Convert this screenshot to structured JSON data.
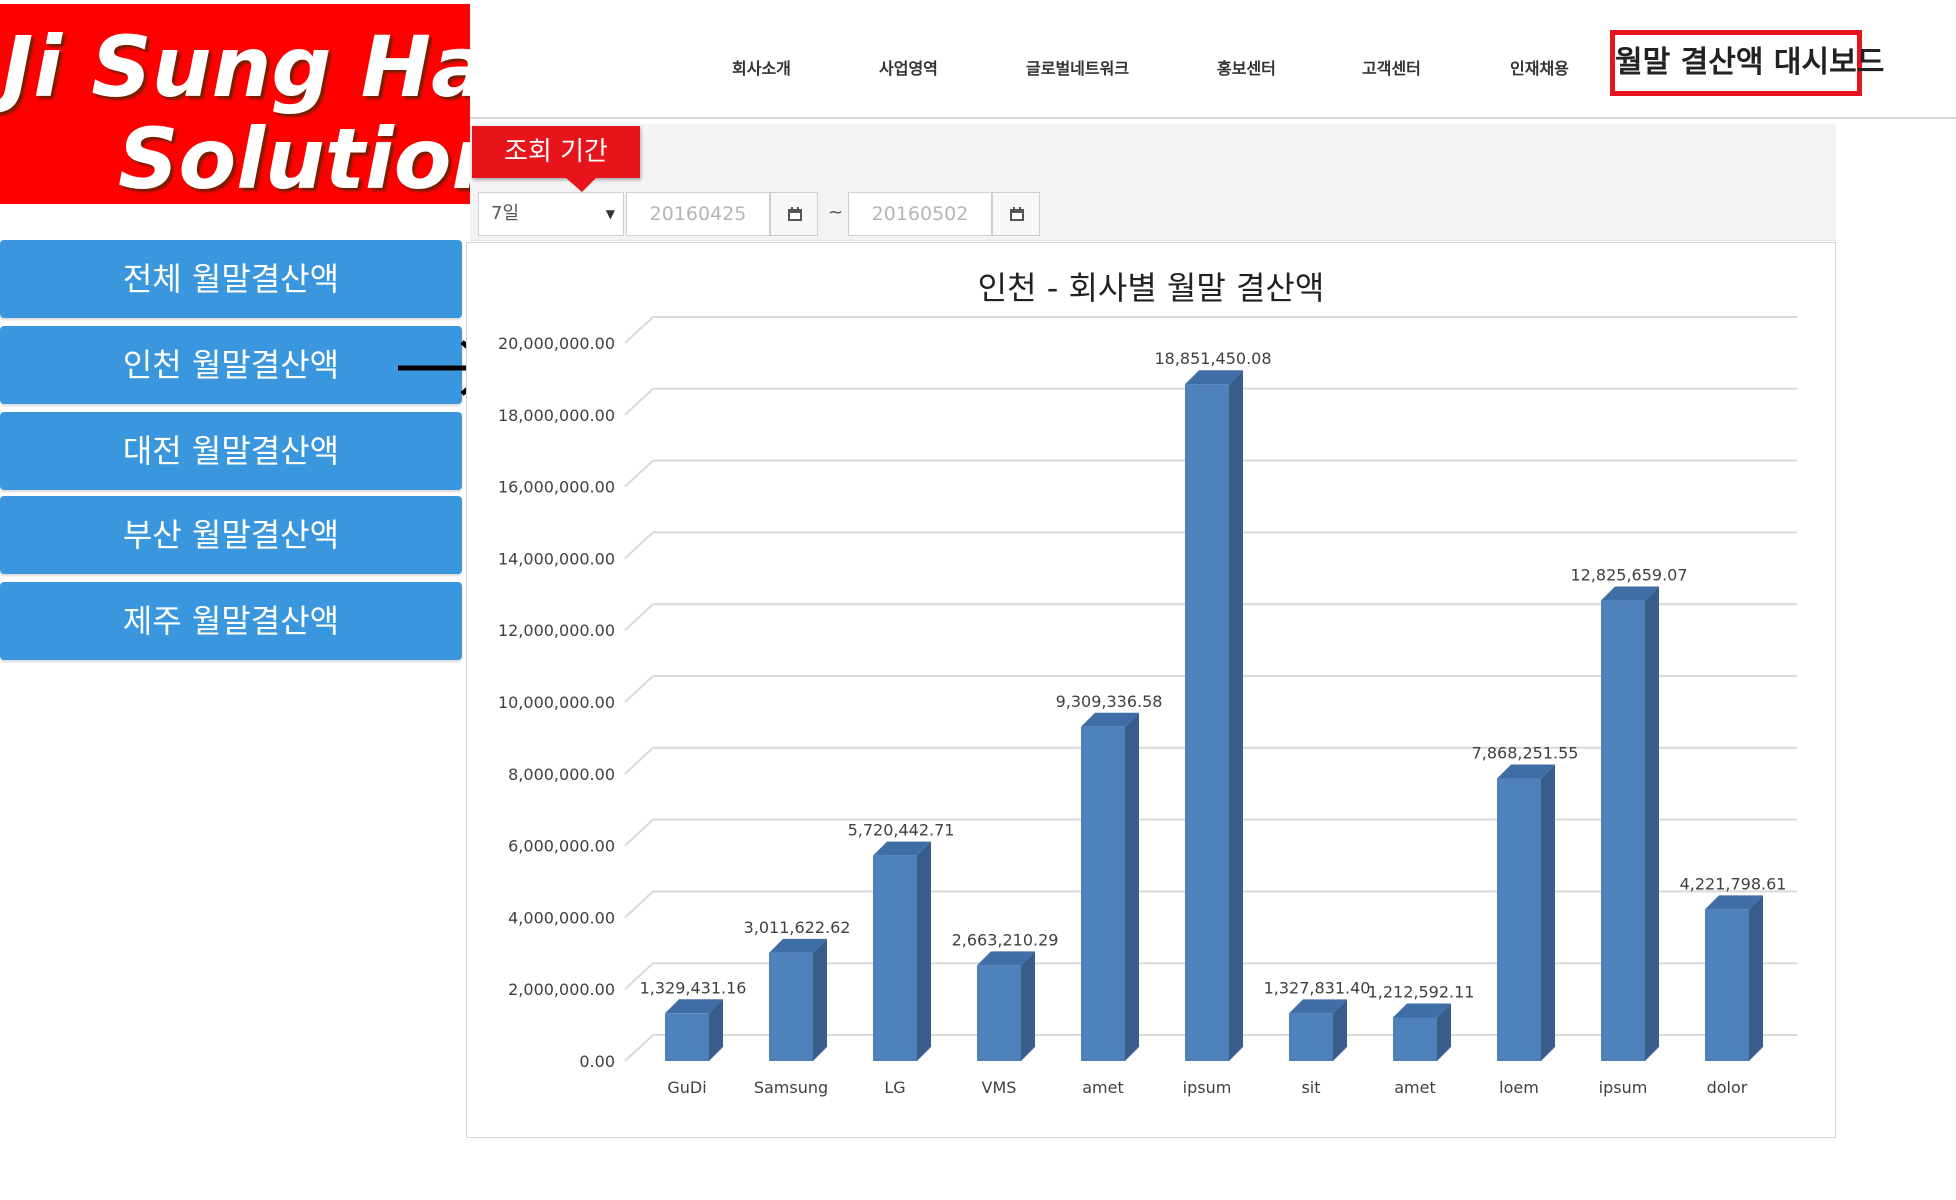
{
  "logo": {
    "line1": "Ji Sung Han",
    "line2": "Solutions"
  },
  "nav": {
    "items": [
      "회사소개",
      "사업영역",
      "글로벌네트워크",
      "홍보센터",
      "고객센터",
      "인재채용"
    ],
    "dashboard_label": "월말 결산액 대시보드"
  },
  "sidebar": {
    "items": [
      {
        "label": "전체 월말결산액"
      },
      {
        "label": "인천 월말결산액"
      },
      {
        "label": "대전 월말결산액"
      },
      {
        "label": "부산 월말결산액"
      },
      {
        "label": "제주 월말결산액"
      }
    ],
    "active_index": 1
  },
  "filter": {
    "tag_label": "조회 기간",
    "period_value": "7일",
    "start_date": "20160425",
    "end_date": "20160502",
    "separator": "~"
  },
  "colors": {
    "bar_front": "#4f81bd",
    "bar_side": "#385d8a",
    "bar_top": "#3f6ea7",
    "sidebar": "#3a97dd",
    "accent_red": "#e8141c"
  },
  "chart_data": {
    "type": "bar",
    "title": "인천 - 회사별 월말 결산액",
    "categories": [
      "GuDi",
      "Samsung",
      "LG",
      "VMS",
      "amet",
      "ipsum",
      "sit",
      "amet",
      "loem",
      "ipsum",
      "dolor"
    ],
    "values": [
      1329431.16,
      3011622.62,
      5720442.71,
      2663210.29,
      9309336.58,
      18851450.08,
      1327831.4,
      1212592.11,
      7868251.55,
      12825659.07,
      4221798.61
    ],
    "value_labels": [
      "1,329,431.16",
      "3,011,622.62",
      "5,720,442.71",
      "2,663,210.29",
      "9,309,336.58",
      "18,851,450.08",
      "1,327,831.40",
      "1,212,592.11",
      "7,868,251.55",
      "12,825,659.07",
      "4,221,798.61"
    ],
    "y_ticks": [
      0,
      2000000,
      4000000,
      6000000,
      8000000,
      10000000,
      12000000,
      14000000,
      16000000,
      18000000,
      20000000
    ],
    "y_tick_labels": [
      "0.00",
      "2,000,000.00",
      "4,000,000.00",
      "6,000,000.00",
      "8,000,000.00",
      "10,000,000.00",
      "12,000,000.00",
      "14,000,000.00",
      "16,000,000.00",
      "18,000,000.00",
      "20,000,000.00"
    ],
    "ylim": [
      0,
      20000000
    ],
    "grid": true,
    "style": "3d-column",
    "xlabel": "",
    "ylabel": ""
  }
}
